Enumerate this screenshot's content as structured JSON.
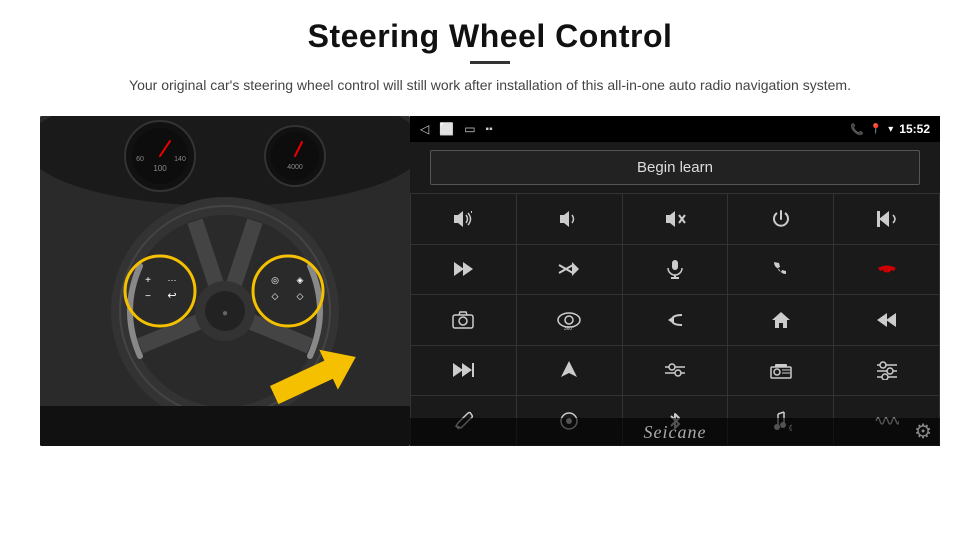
{
  "page": {
    "title": "Steering Wheel Control",
    "divider": true,
    "subtitle": "Your original car's steering wheel control will still work after installation of this all-in-one auto radio navigation system."
  },
  "status_bar": {
    "time": "15:52",
    "icons": [
      "phone-icon",
      "location-icon",
      "wifi-icon",
      "signal-icon"
    ]
  },
  "begin_learn": {
    "label": "Begin learn"
  },
  "control_grid": {
    "rows": [
      [
        "vol+",
        "vol-",
        "mute",
        "power",
        "prev-call"
      ],
      [
        "next",
        "shuffle-fwd",
        "mic",
        "phone",
        "hang-up"
      ],
      [
        "cam",
        "360view",
        "back",
        "home",
        "skip-back"
      ],
      [
        "ff",
        "nav",
        "eq",
        "radio",
        "sliders"
      ],
      [
        "pen",
        "circle",
        "bluetooth",
        "music",
        "wave"
      ]
    ]
  },
  "branding": {
    "logo": "Seicane"
  },
  "icons": {
    "gear": "⚙"
  }
}
